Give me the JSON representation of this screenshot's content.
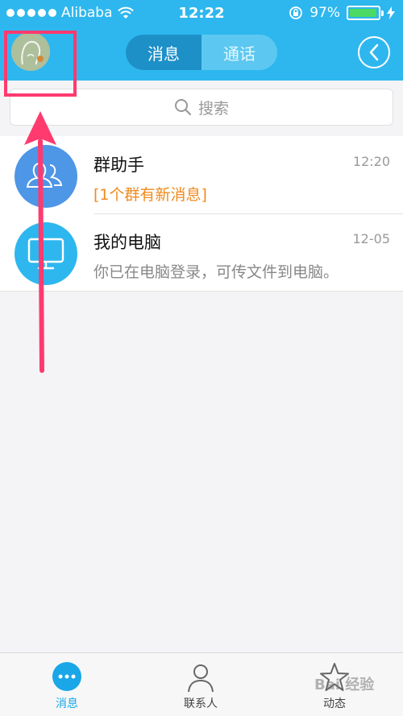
{
  "status": {
    "carrier": "Alibaba",
    "time": "12:22",
    "battery_text": "97%",
    "battery_level": 0.97
  },
  "header": {
    "tabs": [
      {
        "label": "消息",
        "active": true
      },
      {
        "label": "通话",
        "active": false
      }
    ],
    "colors": {
      "bar": "#2eb7ee",
      "active_tab": "#1e90c8"
    }
  },
  "search": {
    "placeholder": "搜索"
  },
  "conversations": [
    {
      "name": "群助手",
      "time": "12:20",
      "preview": "[1个群有新消息]",
      "preview_color": "#f08a1d",
      "avatar_color": "#4e96e6",
      "icon": "group-icon"
    },
    {
      "name": "我的电脑",
      "time": "12-05",
      "preview": "你已在电脑登录，可传文件到电脑。",
      "preview_color": "#888888",
      "avatar_color": "#2eb7ee",
      "icon": "monitor-icon"
    }
  ],
  "tabbar": [
    {
      "label": "消息",
      "icon": "chat-bubble-icon",
      "active": true
    },
    {
      "label": "联系人",
      "icon": "contacts-icon",
      "active": false
    },
    {
      "label": "动态",
      "icon": "star-icon",
      "active": false
    }
  ],
  "watermark": "Bai 经验"
}
